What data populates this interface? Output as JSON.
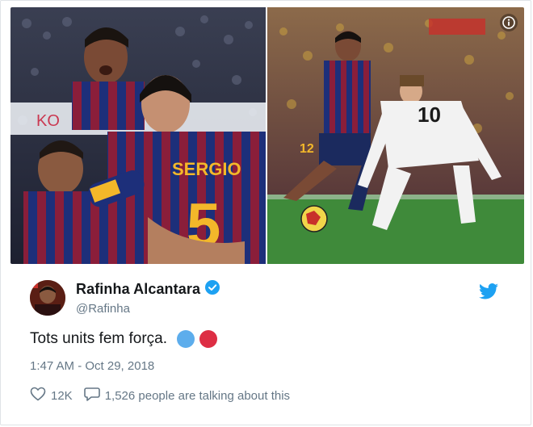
{
  "tweet": {
    "author_name": "Rafinha Alcantara",
    "author_handle": "@Rafinha",
    "text": "Tots units fem força.",
    "timestamp": "1:47 AM - Oct 29, 2018",
    "likes": "12K",
    "replies_text": "1,526 people are talking about this",
    "verified": true
  },
  "media": {
    "left_photo": {
      "jersey_name": "SERGIO",
      "jersey_number": "5"
    },
    "right_photo": {
      "number_left": "12",
      "number_right": "10"
    }
  },
  "emoji": [
    {
      "name": "blue-circle",
      "color": "#5dadec"
    },
    {
      "name": "red-circle",
      "color": "#dd2e44"
    }
  ],
  "colors": {
    "twitter_blue": "#1da1f2",
    "text": "#14171a",
    "secondary_text": "#657786"
  },
  "icons": {
    "info": "info-icon",
    "twitter": "twitter-bird-icon",
    "verified": "verified-badge-icon",
    "like": "heart-icon",
    "reply": "comment-bubble-icon"
  }
}
